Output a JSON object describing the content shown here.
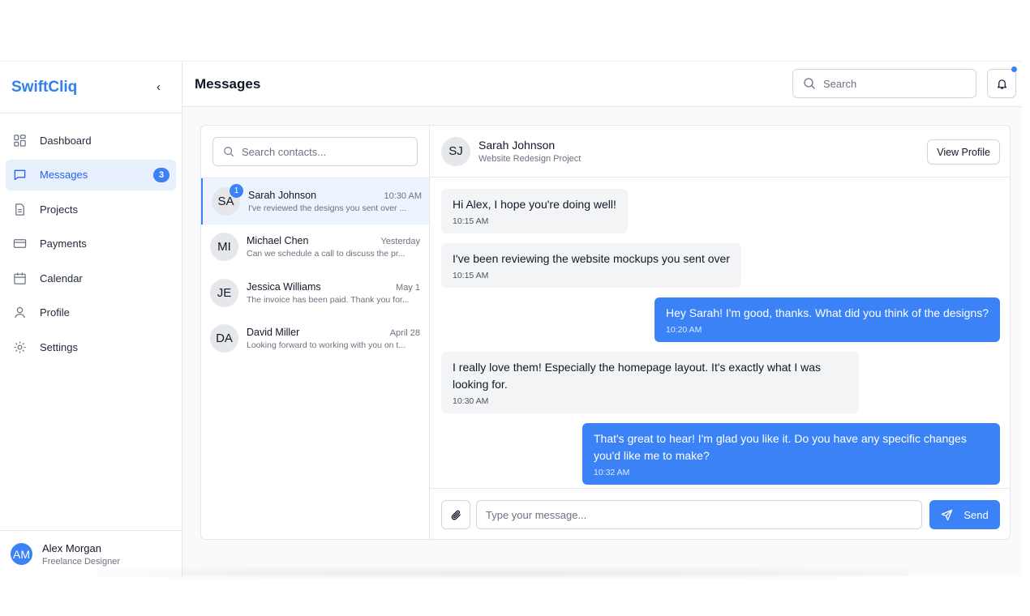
{
  "brand": "SwiftCliq",
  "collapse_glyph": "‹",
  "sidebar": {
    "items": [
      {
        "label": "Dashboard",
        "icon": "dashboard-icon"
      },
      {
        "label": "Messages",
        "icon": "message-icon",
        "badge": "3",
        "active": true
      },
      {
        "label": "Projects",
        "icon": "document-icon"
      },
      {
        "label": "Payments",
        "icon": "credit-card-icon"
      },
      {
        "label": "Calendar",
        "icon": "calendar-icon"
      },
      {
        "label": "Profile",
        "icon": "user-icon"
      },
      {
        "label": "Settings",
        "icon": "gear-icon"
      }
    ],
    "user": {
      "initials": "AM",
      "name": "Alex Morgan",
      "role": "Freelance Designer"
    }
  },
  "header": {
    "title": "Messages",
    "search_placeholder": "Search"
  },
  "contacts": {
    "search_placeholder": "Search contacts...",
    "list": [
      {
        "initials": "SA",
        "name": "Sarah Johnson",
        "time": "10:30 AM",
        "preview": "I've reviewed the designs you sent over ...",
        "unread": "1"
      },
      {
        "initials": "MI",
        "name": "Michael Chen",
        "time": "Yesterday",
        "preview": "Can we schedule a call to discuss the pr..."
      },
      {
        "initials": "JE",
        "name": "Jessica Williams",
        "time": "May 1",
        "preview": "The invoice has been paid. Thank you for..."
      },
      {
        "initials": "DA",
        "name": "David Miller",
        "time": "April 28",
        "preview": "Looking forward to working with you on t..."
      }
    ]
  },
  "chat": {
    "initials": "SJ",
    "name": "Sarah Johnson",
    "project": "Website Redesign Project",
    "view_profile": "View Profile",
    "messages": [
      {
        "direction": "in",
        "text": "Hi Alex, I hope you're doing well!",
        "time": "10:15 AM"
      },
      {
        "direction": "in",
        "text": "I've been reviewing the website mockups you sent over",
        "time": "10:15 AM"
      },
      {
        "direction": "out",
        "text": "Hey Sarah! I'm good, thanks. What did you think of the designs?",
        "time": "10:20 AM"
      },
      {
        "direction": "in",
        "text": "I really love them! Especially the homepage layout. It's exactly what I was looking for.",
        "time": "10:30 AM"
      },
      {
        "direction": "out",
        "text": "That's great to hear! I'm glad you like it. Do you have any specific changes you'd like me to make?",
        "time": "10:32 AM"
      }
    ],
    "composer_placeholder": "Type your message...",
    "send_label": "Send"
  },
  "colors": {
    "accent": "#3b82f6",
    "brand": "#2f80ed",
    "active_bg": "#e8f0fd",
    "bubble_in": "#f3f4f6"
  }
}
